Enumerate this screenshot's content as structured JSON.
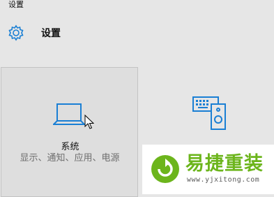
{
  "window": {
    "title": "设置"
  },
  "header": {
    "title": "设置",
    "icon": "gear-icon"
  },
  "tiles": [
    {
      "label": "系统",
      "description": "显示、通知、应用、电源",
      "icon": "laptop-icon"
    },
    {
      "label": "",
      "icon": "devices-icon"
    }
  ],
  "watermark": {
    "brand": "易捷重装",
    "url": "www.yjxitong.com"
  },
  "colors": {
    "accent": "#1a7fd4",
    "brand": "#6cb51c"
  }
}
